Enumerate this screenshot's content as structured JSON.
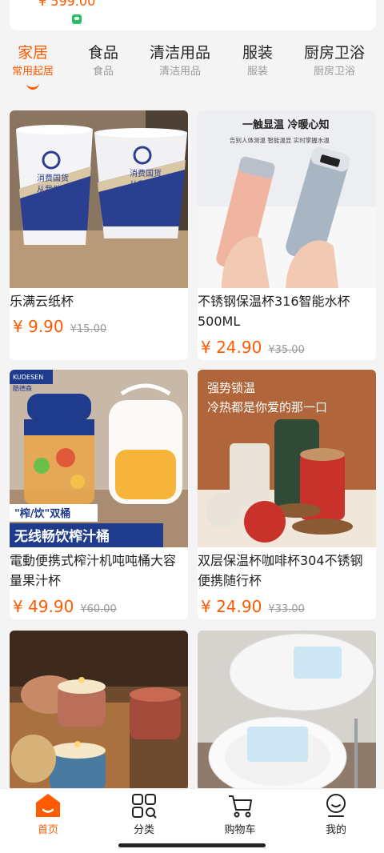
{
  "top_card": {
    "price": "¥ 599.00"
  },
  "tabs": [
    {
      "title": "家居",
      "subtitle": "常用起居"
    },
    {
      "title": "食品",
      "subtitle": "食品"
    },
    {
      "title": "清洁用品",
      "subtitle": "清洁用品"
    },
    {
      "title": "服装",
      "subtitle": "服装"
    },
    {
      "title": "厨房卫浴",
      "subtitle": "厨房卫浴"
    }
  ],
  "products": [
    {
      "title": "乐满云纸杯",
      "price": "¥ 9.90",
      "old_price": "¥15.00",
      "image_text": [
        "消费国货",
        "从我做起"
      ]
    },
    {
      "title": "不锈钢保温杯316智能水杯500ML",
      "price": "¥ 24.90",
      "old_price": "¥35.00",
      "image_text": [
        "一触显温 冷暖心知",
        "告别人体测温 智能温显 实时掌握水温"
      ]
    },
    {
      "title": "電動便携式榨汁机吨吨桶大容量果汁杯",
      "price": "¥ 49.90",
      "old_price": "¥60.00",
      "image_text": [
        "KUDESEN",
        "酷德森",
        "\"榨/饮\"双桶",
        "无线畅饮榨汁桶"
      ]
    },
    {
      "title": "双层保温杯咖啡杯304不锈钢便携随行杯",
      "price": "¥ 24.90",
      "old_price": "¥33.00",
      "image_text": [
        "强势锁温",
        "冷热都是你爱的那一口"
      ]
    },
    {
      "title": "",
      "price": "",
      "old_price": "",
      "image_text": []
    },
    {
      "title": "",
      "price": "",
      "old_price": "",
      "image_text": []
    }
  ],
  "bottom_nav": [
    {
      "label": "首页",
      "icon": "home-icon"
    },
    {
      "label": "分类",
      "icon": "category-icon"
    },
    {
      "label": "购物车",
      "icon": "cart-icon"
    },
    {
      "label": "我的",
      "icon": "profile-icon"
    }
  ],
  "colors": {
    "accent": "#ff5a00",
    "background": "#f4f4f4"
  }
}
